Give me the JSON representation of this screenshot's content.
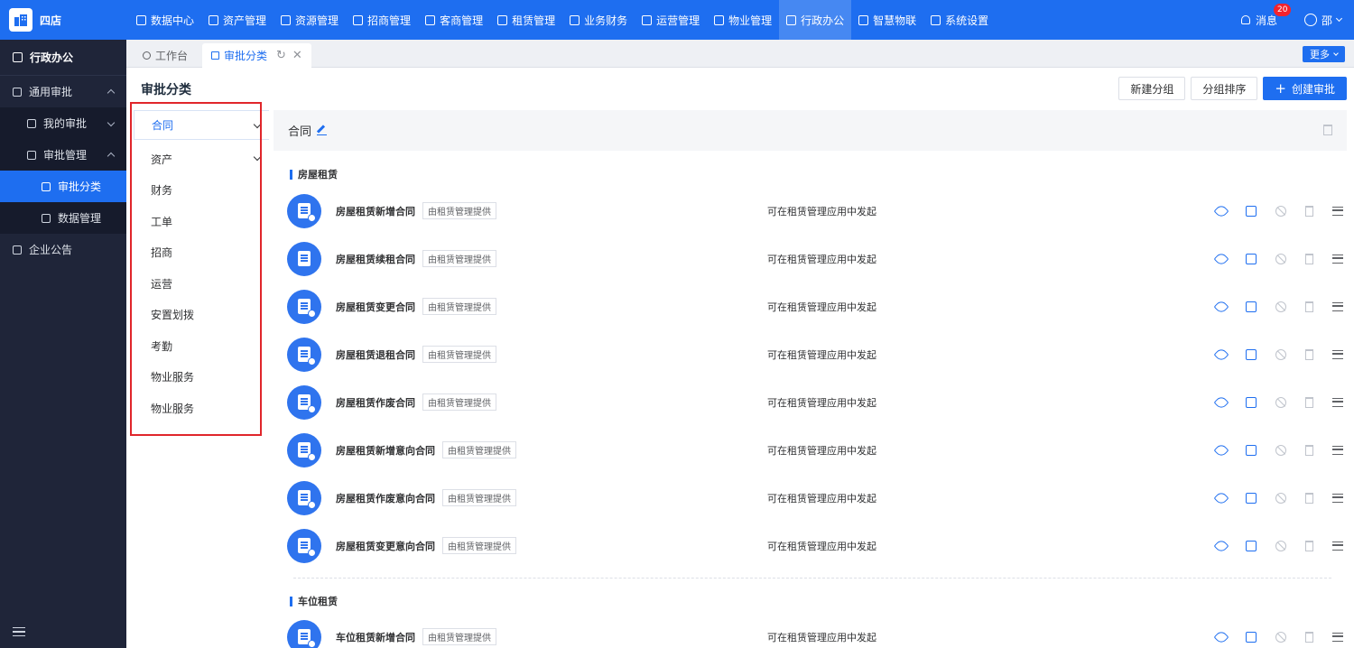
{
  "brand": {
    "name": "四店"
  },
  "topnav": [
    {
      "label": "数据中心",
      "icon": "dashboard-icon"
    },
    {
      "label": "资产管理",
      "icon": "box-icon"
    },
    {
      "label": "资源管理",
      "icon": "building-icon"
    },
    {
      "label": "招商管理",
      "icon": "tag-icon"
    },
    {
      "label": "客商管理",
      "icon": "users-icon"
    },
    {
      "label": "租赁管理",
      "icon": "house-icon"
    },
    {
      "label": "业务财务",
      "icon": "money-icon"
    },
    {
      "label": "运营管理",
      "icon": "chart-icon"
    },
    {
      "label": "物业管理",
      "icon": "home-icon"
    },
    {
      "label": "行政办公",
      "icon": "monitor-icon",
      "active": true
    },
    {
      "label": "智慧物联",
      "icon": "network-icon"
    },
    {
      "label": "系统设置",
      "icon": "gear-icon"
    }
  ],
  "header": {
    "messages_label": "消息",
    "messages_badge": "20",
    "user_label": "邵"
  },
  "sidebar": {
    "head": "行政办公",
    "items": [
      {
        "label": "通用审批"
      },
      {
        "label": "我的审批"
      },
      {
        "label": "审批管理"
      },
      {
        "label": "审批分类"
      },
      {
        "label": "数据管理"
      },
      {
        "label": "企业公告"
      }
    ]
  },
  "tabs": {
    "workbench": "工作台",
    "current": "审批分类",
    "more": "更多"
  },
  "page": {
    "title": "审批分类"
  },
  "toolbar": {
    "new_group": "新建分组",
    "group_sort": "分组排序",
    "create": "创建审批"
  },
  "categories": [
    "合同",
    "资产",
    "财务",
    "工单",
    "招商",
    "运营",
    "安置划拨",
    "考勤",
    "物业服务",
    "物业服务"
  ],
  "panel": {
    "title": "合同"
  },
  "sections": [
    {
      "title": "房屋租赁"
    },
    {
      "title": "车位租赁"
    }
  ],
  "rows": [
    {
      "name": "房屋租赁新增合同",
      "tag": "由租赁管理提供",
      "desc": "可在租赁管理应用中发起"
    },
    {
      "name": "房屋租赁续租合同",
      "tag": "由租赁管理提供",
      "desc": "可在租赁管理应用中发起"
    },
    {
      "name": "房屋租赁变更合同",
      "tag": "由租赁管理提供",
      "desc": "可在租赁管理应用中发起"
    },
    {
      "name": "房屋租赁退租合同",
      "tag": "由租赁管理提供",
      "desc": "可在租赁管理应用中发起"
    },
    {
      "name": "房屋租赁作废合同",
      "tag": "由租赁管理提供",
      "desc": "可在租赁管理应用中发起"
    },
    {
      "name": "房屋租赁新增意向合同",
      "tag": "由租赁管理提供",
      "desc": "可在租赁管理应用中发起"
    },
    {
      "name": "房屋租赁作废意向合同",
      "tag": "由租赁管理提供",
      "desc": "可在租赁管理应用中发起"
    },
    {
      "name": "房屋租赁变更意向合同",
      "tag": "由租赁管理提供",
      "desc": "可在租赁管理应用中发起"
    },
    {
      "name": "车位租赁新增合同",
      "tag": "由租赁管理提供",
      "desc": "可在租赁管理应用中发起"
    }
  ],
  "colors": {
    "primary": "#1e6ef0",
    "sidebar": "#1f2539",
    "highlight": "#e0262b"
  }
}
